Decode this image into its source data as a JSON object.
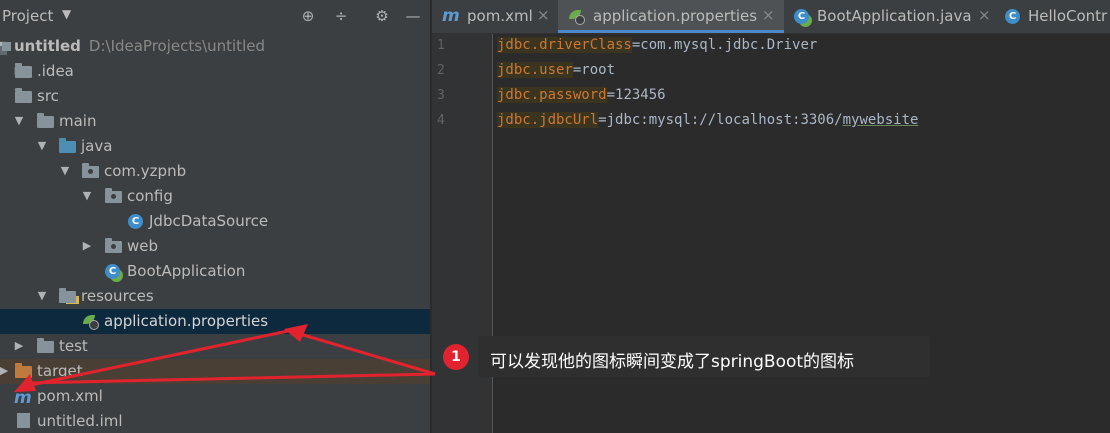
{
  "project_panel": {
    "title": "Project",
    "tools": {
      "locate": "⊕",
      "collapse": "÷",
      "settings": "⚙",
      "hide": "—"
    },
    "tree": [
      {
        "label": "untitled",
        "path": "D:\\IdeaProjects\\untitled",
        "icon": "module-icon"
      },
      {
        "label": ".idea",
        "icon": "folder-icon"
      },
      {
        "label": "src",
        "icon": "folder-icon"
      },
      {
        "label": "main",
        "icon": "folder-icon"
      },
      {
        "label": "java",
        "icon": "source-folder-icon"
      },
      {
        "label": "com.yzpnb",
        "icon": "package-icon"
      },
      {
        "label": "config",
        "icon": "package-icon"
      },
      {
        "label": "JdbcDataSource",
        "icon": "class-icon"
      },
      {
        "label": "web",
        "icon": "package-icon"
      },
      {
        "label": "BootApplication",
        "icon": "spring-boot-class-icon"
      },
      {
        "label": "resources",
        "icon": "resources-folder-icon"
      },
      {
        "label": "application.properties",
        "icon": "spring-boot-properties-icon"
      },
      {
        "label": "test",
        "icon": "folder-icon"
      },
      {
        "label": "target",
        "icon": "excluded-folder-icon"
      },
      {
        "label": "pom.xml",
        "icon": "maven-icon"
      },
      {
        "label": "untitled.iml",
        "icon": "iml-file-icon"
      }
    ]
  },
  "editor": {
    "tabs": [
      {
        "label": "pom.xml",
        "icon": "maven-icon",
        "close": "×"
      },
      {
        "label": "application.properties",
        "icon": "spring-boot-properties-icon",
        "close": "×",
        "active": true
      },
      {
        "label": "BootApplication.java",
        "icon": "spring-boot-class-icon",
        "close": "×"
      },
      {
        "label": "HelloContr",
        "icon": "class-icon"
      }
    ],
    "lines": [
      {
        "num": "1",
        "key": "jdbc.driverClass",
        "eq": "=",
        "value": "com.mysql.jdbc.Driver"
      },
      {
        "num": "2",
        "key": "jdbc.user",
        "eq": "=",
        "value": "root"
      },
      {
        "num": "3",
        "key": "jdbc.password",
        "eq": "=",
        "value": "123456"
      },
      {
        "num": "4",
        "key": "jdbc.jdbcUrl",
        "eq": "=",
        "value": "jdbc:mysql://localhost:3306/",
        "value_underlined": "mywebsite"
      }
    ]
  },
  "annotation": {
    "number": "1",
    "text": "可以发现他的图标瞬间变成了springBoot的图标",
    "color": "#e0232e"
  }
}
